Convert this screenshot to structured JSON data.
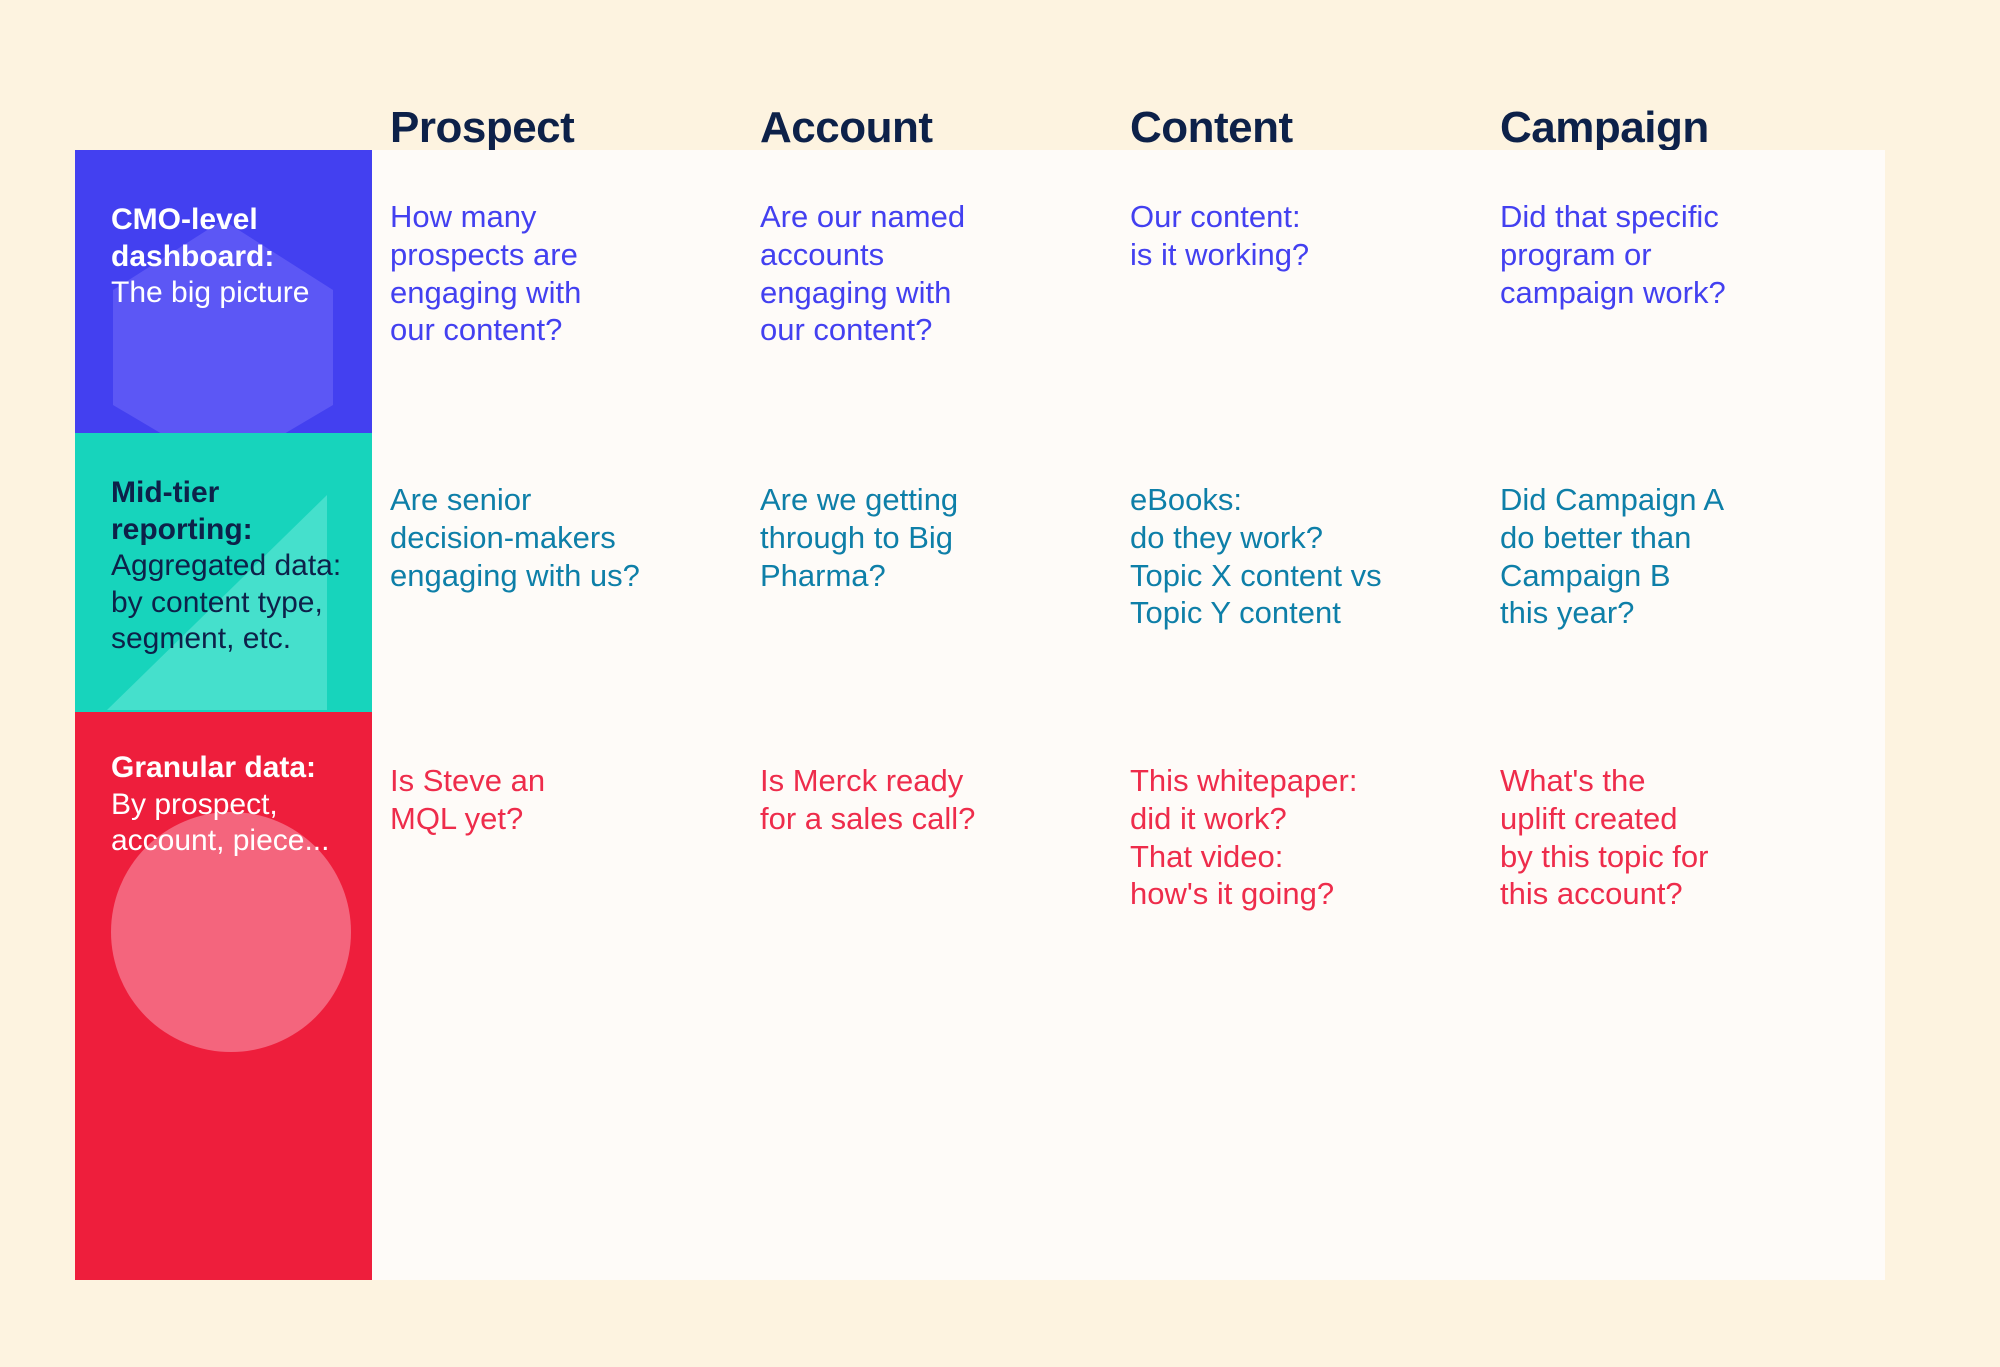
{
  "palette": {
    "background": "#FDF3E0",
    "table_background": "#FEFBF8",
    "header_text": "#0D2149",
    "row1_fill": "#4340F0",
    "row1_text": "#4340F0",
    "row1_watermark": "#5C57F5",
    "row2_fill": "#17D4BC",
    "row2_text": "#0E7FA8",
    "row2_watermark": "#45E0CC",
    "row3_fill": "#EE1E3C",
    "row3_text": "#EE2C4B",
    "row3_watermark": "#F4657D"
  },
  "columns": [
    {
      "label": "Prospect"
    },
    {
      "label": "Account"
    },
    {
      "label": "Content"
    },
    {
      "label": "Campaign"
    }
  ],
  "rows": [
    {
      "title": "CMO-level\ndashboard:",
      "subtitle": "The big picture",
      "watermark_icon": "hexagon-shape",
      "cells": [
        "How many\nprospects are\nengaging with\nour content?",
        "Are our named\naccounts\nengaging with\nour content?",
        "Our content:\nis it working?",
        "Did that specific\nprogram or\ncampaign work?"
      ]
    },
    {
      "title": "Mid-tier\nreporting:",
      "subtitle": "Aggregated data:\nby content type,\nsegment, etc.",
      "watermark_icon": "triangle-shape",
      "cells": [
        "Are senior\ndecision-makers\nengaging with us?",
        "Are we getting\nthrough to Big\nPharma?",
        "eBooks:\ndo they work?\nTopic X content vs\nTopic Y content",
        "Did Campaign A\ndo better than\nCampaign B\nthis year?"
      ]
    },
    {
      "title": "Granular data:",
      "subtitle": "By prospect,\naccount, piece...",
      "watermark_icon": "circle-shape",
      "cells": [
        "Is Steve an\nMQL yet?",
        "Is Merck ready\nfor a sales call?",
        "This whitepaper:\ndid it work?\nThat video:\nhow's it going?",
        "What's the\nuplift created\nby this topic for\nthis account?"
      ]
    }
  ]
}
